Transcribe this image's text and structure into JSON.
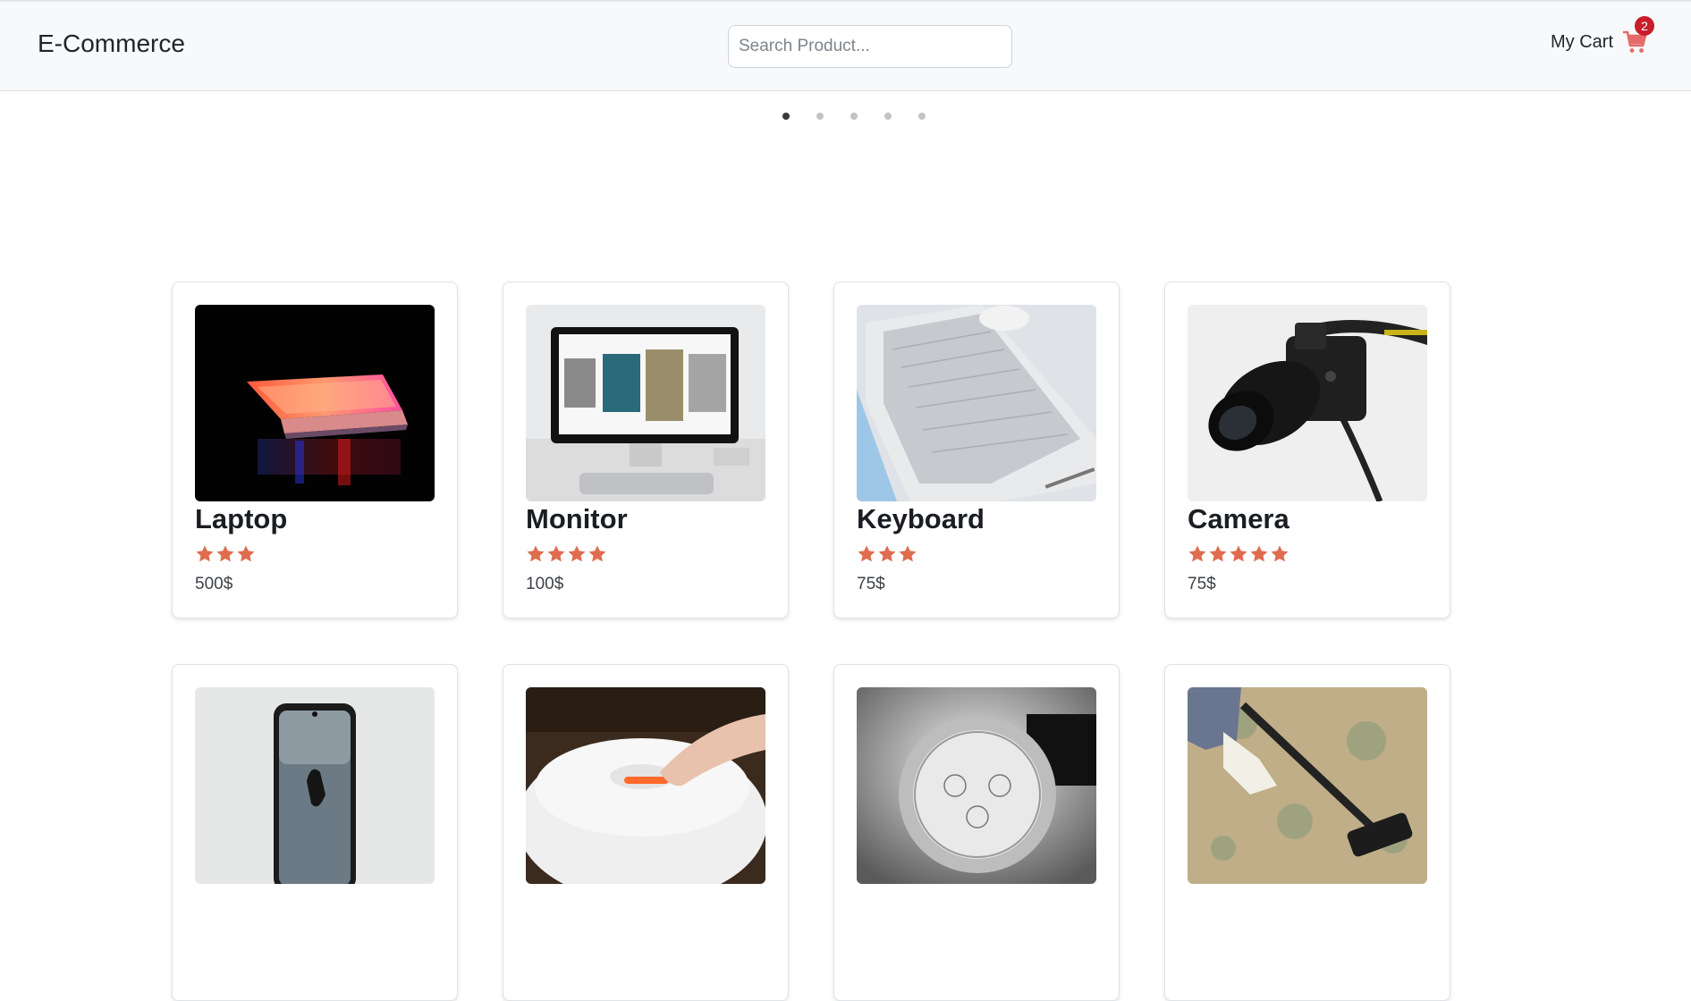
{
  "navbar": {
    "brand": "E-Commerce",
    "search_placeholder": "Search Product...",
    "cart_label": "My Cart",
    "cart_count": "2"
  },
  "colors": {
    "star": "#e06c4f",
    "badge": "#c81e2a",
    "cart_icon": "#e66a6a"
  },
  "carousel": {
    "slide_count": 5,
    "active_index": 0
  },
  "products": [
    {
      "name": "Laptop",
      "rating": 3,
      "price": "500$",
      "image": "laptop-photo"
    },
    {
      "name": "Monitor",
      "rating": 4,
      "price": "100$",
      "image": "monitor-photo"
    },
    {
      "name": "Keyboard",
      "rating": 3,
      "price": "75$",
      "image": "keyboard-photo"
    },
    {
      "name": "Camera",
      "rating": 5,
      "price": "75$",
      "image": "camera-photo"
    },
    {
      "name": "",
      "rating": 0,
      "price": "",
      "image": "smartphone-photo"
    },
    {
      "name": "",
      "rating": 0,
      "price": "",
      "image": "robot-vacuum-photo"
    },
    {
      "name": "",
      "rating": 0,
      "price": "",
      "image": "watch-photo"
    },
    {
      "name": "",
      "rating": 0,
      "price": "",
      "image": "vacuum-cleaner-photo"
    }
  ]
}
